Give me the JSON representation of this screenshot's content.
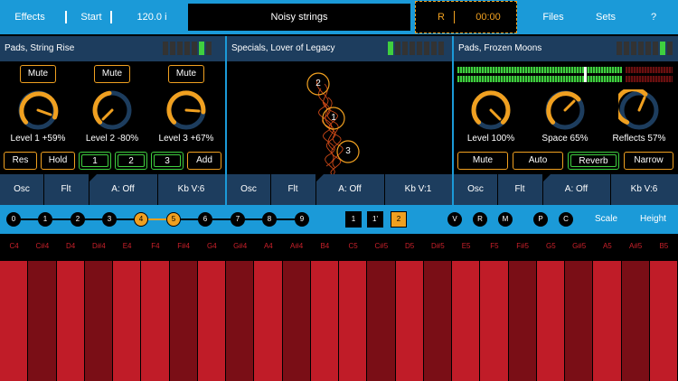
{
  "topbar": {
    "effects": "Effects",
    "start": "Start",
    "tempo": "120.0 i",
    "preset": "Noisy strings",
    "rec": "R",
    "time": "00:00",
    "files": "Files",
    "sets": "Sets",
    "help": "?"
  },
  "panels": [
    {
      "title": "Pads, String Rise",
      "mutes": [
        "Mute",
        "Mute",
        "Mute"
      ],
      "knobs": [
        "Level 1 +59%",
        "Level 2 -80%",
        "Level 3 +67%"
      ],
      "buttons": [
        "Res",
        "Hold",
        "1",
        "2",
        "3",
        "Add"
      ]
    },
    {
      "title": "Specials, Lover of Legacy",
      "nodes": [
        "2",
        "1",
        "3"
      ]
    },
    {
      "title": "Pads, Frozen Moons",
      "knobs": [
        "Level 100%",
        "Space 65%",
        "Reflects 57%"
      ],
      "buttons": [
        "Mute",
        "Auto",
        "Reverb",
        "Narrow"
      ]
    }
  ],
  "controls": [
    [
      "Osc",
      "Flt",
      "A: Off",
      "Kb V:6"
    ],
    [
      "Osc",
      "Flt",
      "A: Off",
      "Kb V:1"
    ],
    [
      "Osc",
      "Flt",
      "A: Off",
      "Kb V:6"
    ]
  ],
  "octaves": [
    "0",
    "1",
    "2",
    "3",
    "4",
    "5",
    "6",
    "7",
    "8",
    "9"
  ],
  "selected_octaves": [
    4,
    5
  ],
  "shift_buttons": [
    "1",
    "1'",
    "2"
  ],
  "modifiers": [
    "V",
    "R",
    "M",
    "P",
    "C"
  ],
  "scale_label": "Scale",
  "height_label": "Height",
  "note_labels": [
    "C4",
    "C#4",
    "D4",
    "D#4",
    "E4",
    "F4",
    "F#4",
    "G4",
    "G#4",
    "A4",
    "A#4",
    "B4",
    "C5",
    "C#5",
    "D5",
    "D#5",
    "E5",
    "F5",
    "F#5",
    "G5",
    "G#5",
    "A5",
    "A#5",
    "B5"
  ],
  "colors": {
    "accent": "#1b9ad8",
    "orange": "#f0a020",
    "green": "#3fcf3f",
    "panel": "#1d3d5e",
    "key_light": "#c01c28",
    "key_dark": "#7a0e16"
  }
}
